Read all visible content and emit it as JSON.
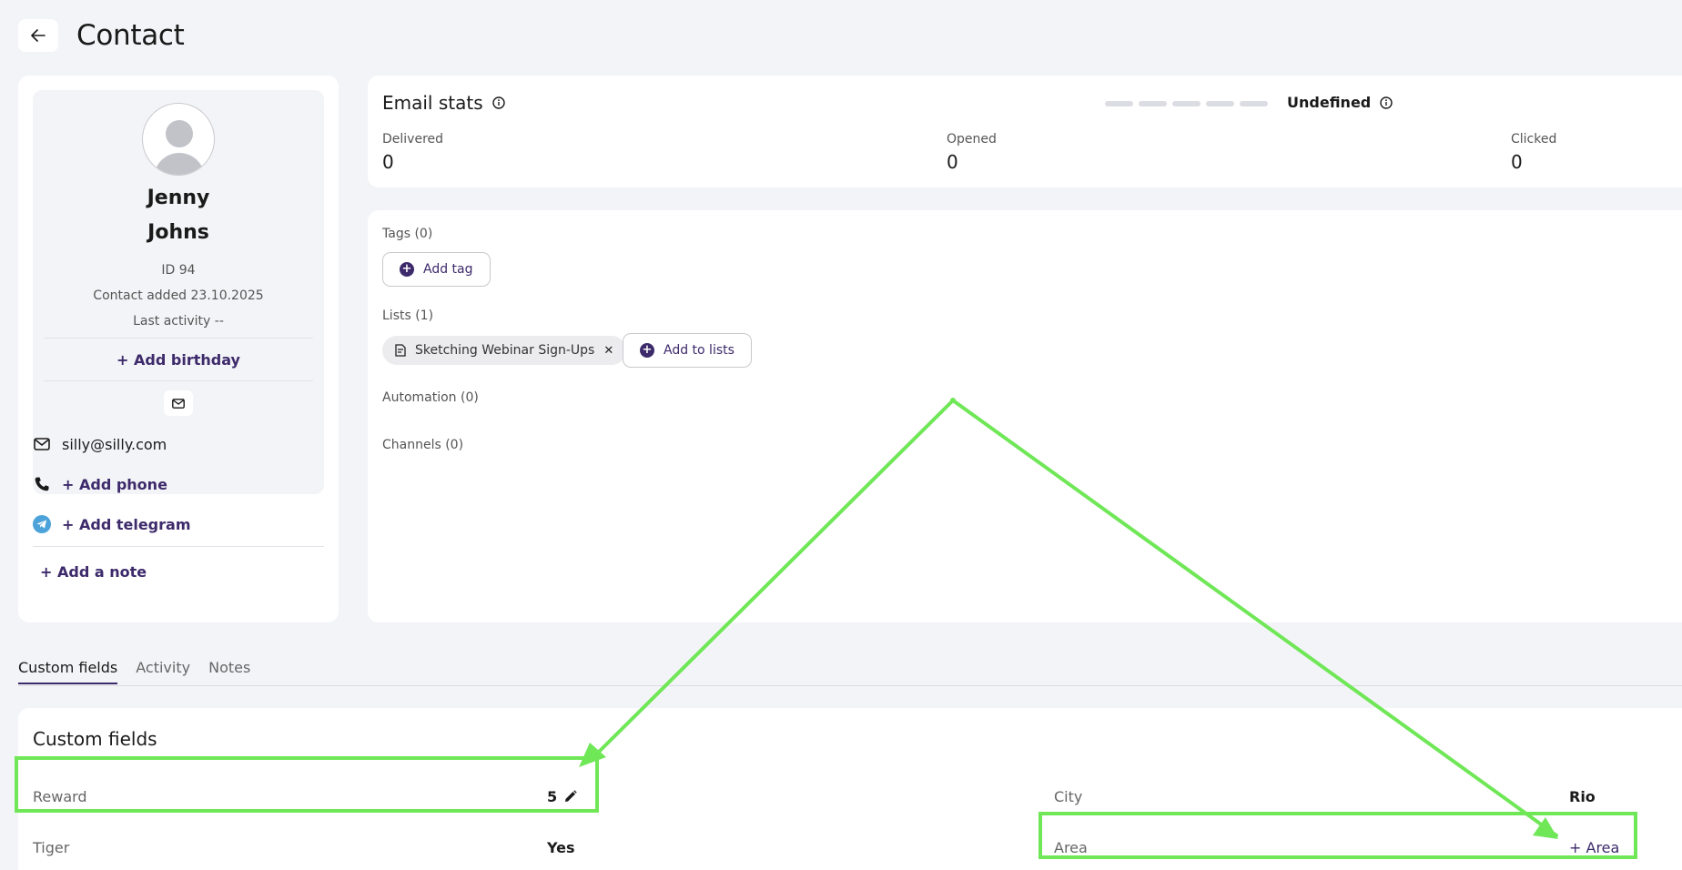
{
  "header": {
    "title": "Contact",
    "back_icon": "arrow-left-icon"
  },
  "profile": {
    "first_name": "Jenny",
    "last_name": "Johns",
    "id_text": "ID 94",
    "added_text": "Contact added 23.10.2025",
    "last_activity_text": "Last activity --",
    "add_birthday_label": "+ Add birthday",
    "email": "silly@silly.com",
    "add_phone_label": "+ Add phone",
    "add_telegram_label": "+ Add telegram",
    "add_note_label": "+ Add a note"
  },
  "email_stats": {
    "title": "Email stats",
    "status": "Undefined",
    "stats": [
      {
        "label": "Delivered",
        "value": "0"
      },
      {
        "label": "Opened",
        "value": "0"
      },
      {
        "label": "Clicked",
        "value": "0"
      }
    ]
  },
  "tags": {
    "label": "Tags (0)",
    "add_label": "Add tag"
  },
  "lists": {
    "label": "Lists (1)",
    "items": [
      "Sketching Webinar Sign-Ups"
    ],
    "add_label": "Add to lists"
  },
  "automation": {
    "label": "Automation (0)"
  },
  "channels": {
    "label": "Channels (0)"
  },
  "tabs": [
    "Custom fields",
    "Activity",
    "Notes"
  ],
  "custom_fields": {
    "title": "Custom fields",
    "rows": [
      {
        "key": "Reward",
        "value": "5"
      },
      {
        "key": "Tiger",
        "value": "Yes"
      },
      {
        "key": "City",
        "value": "Rio"
      },
      {
        "key": "Area",
        "value": "+ Area"
      }
    ]
  },
  "colors": {
    "accent": "#3d2a6b",
    "annotation": "#6fe757",
    "background": "#f3f4f7"
  }
}
